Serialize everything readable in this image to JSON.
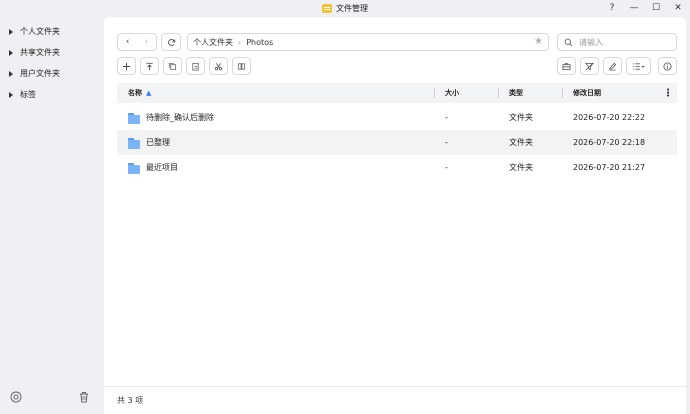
{
  "window": {
    "title": "文件管理",
    "controls": [
      "?",
      "—",
      "☐",
      "✕"
    ]
  },
  "sidebar": {
    "items": [
      {
        "label": "个人文件夹"
      },
      {
        "label": "共享文件夹"
      },
      {
        "label": "用户文件夹"
      },
      {
        "label": "标签"
      }
    ]
  },
  "toolbar": {
    "back": "‹",
    "forward": "›",
    "path": [
      "个人文件夹",
      "Photos"
    ],
    "path_separator": "›",
    "search_placeholder": "请输入"
  },
  "table": {
    "headers": {
      "name": "名称",
      "size": "大小",
      "type": "类型",
      "modified": "修改日期"
    },
    "rows": [
      {
        "name": "待删除_确认后删除",
        "size": "-",
        "type": "文件夹",
        "modified": "2026-07-20 22:22",
        "selected": false
      },
      {
        "name": "已整理",
        "size": "-",
        "type": "文件夹",
        "modified": "2026-07-20 22:18",
        "selected": true
      },
      {
        "name": "最近项目",
        "size": "-",
        "type": "文件夹",
        "modified": "2026-07-20 21:27",
        "selected": false
      }
    ]
  },
  "status": {
    "count_text": "共 3 项"
  },
  "colors": {
    "accent": "#3c82f6",
    "folder": "#7ab3f7",
    "app_logo": "#f3c13a"
  }
}
